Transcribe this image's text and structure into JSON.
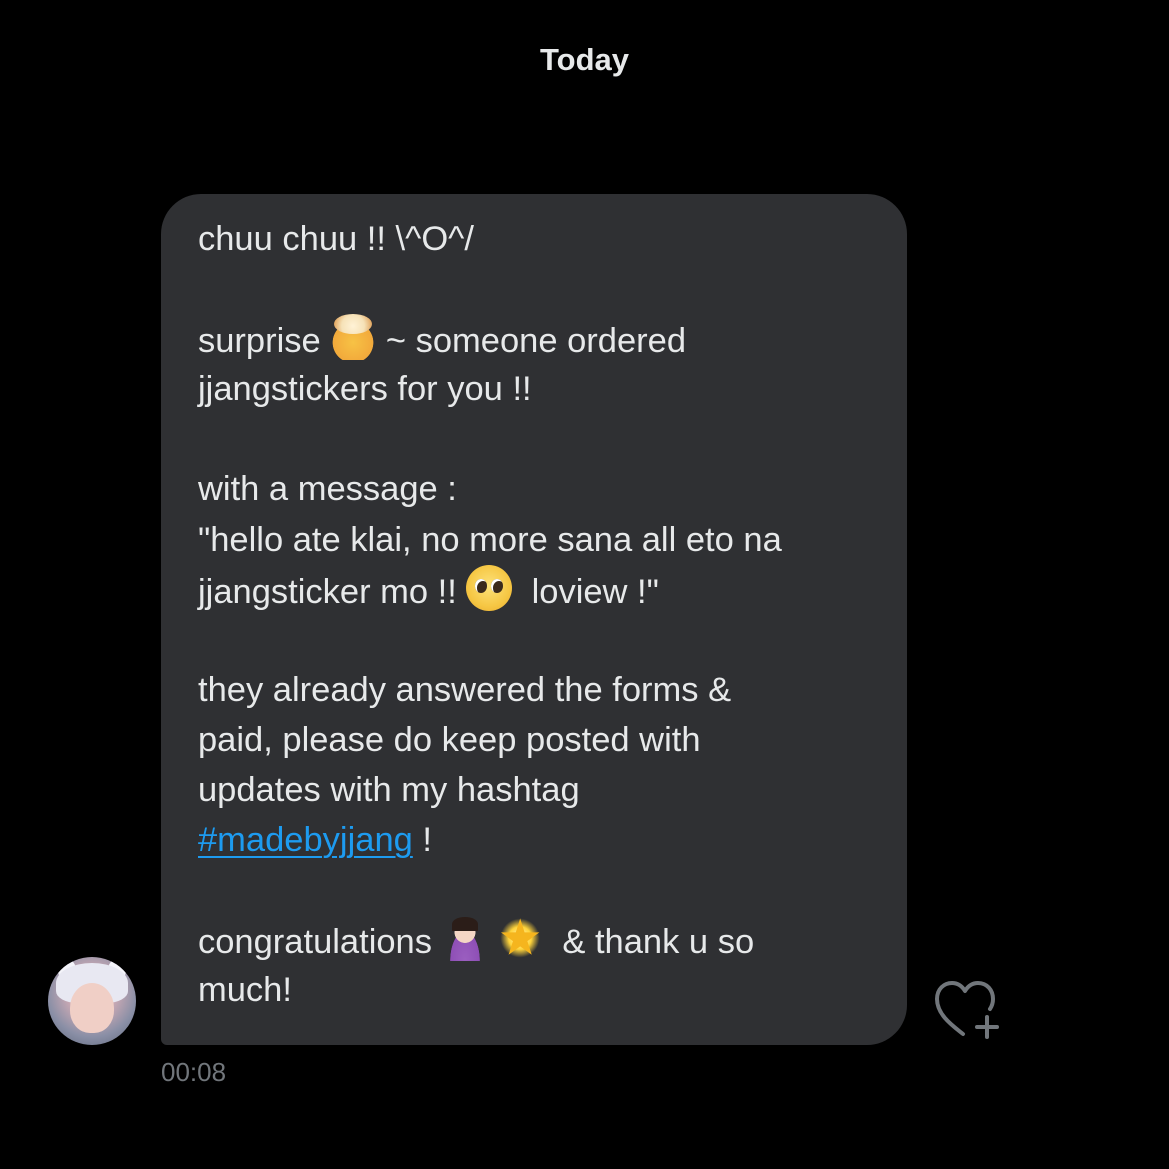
{
  "conversation": {
    "date_label": "Today",
    "message": {
      "lines": [
        {
          "text": "chuu chuu !! \\^O^/"
        },
        {
          "text": ""
        },
        {
          "before": "surprise ",
          "emoji": "🤯",
          "after": " ~ someone ordered"
        },
        {
          "text": "jjangstickers for you !!"
        },
        {
          "text": ""
        },
        {
          "text": "with a message :"
        },
        {
          "text": "\"hello ate klai, no more sana all eto na"
        },
        {
          "before": "jjangsticker mo !! ",
          "emoji": "🥹",
          "after": "  loview !\""
        },
        {
          "text": ""
        },
        {
          "text": "they already answered the forms &"
        },
        {
          "text": "paid, please do keep posted with"
        },
        {
          "text": "updates with my hashtag"
        },
        {
          "hashtag": "#madebyjjang",
          "after": " !"
        },
        {
          "text": ""
        },
        {
          "before": "congratulations ",
          "emoji": "🙆🏻‍♀️",
          "emoji2": "🌟",
          "after": "  & thank u so"
        },
        {
          "text": "much!"
        }
      ],
      "timestamp": "00:08"
    },
    "react_icon": "heart-plus-icon",
    "avatar_icon": "avatar-image"
  },
  "colors": {
    "background": "#000000",
    "bubble": "#2f3033",
    "text": "#e7e9ea",
    "hashtag": "#1d9bf0",
    "muted": "#71767b"
  }
}
